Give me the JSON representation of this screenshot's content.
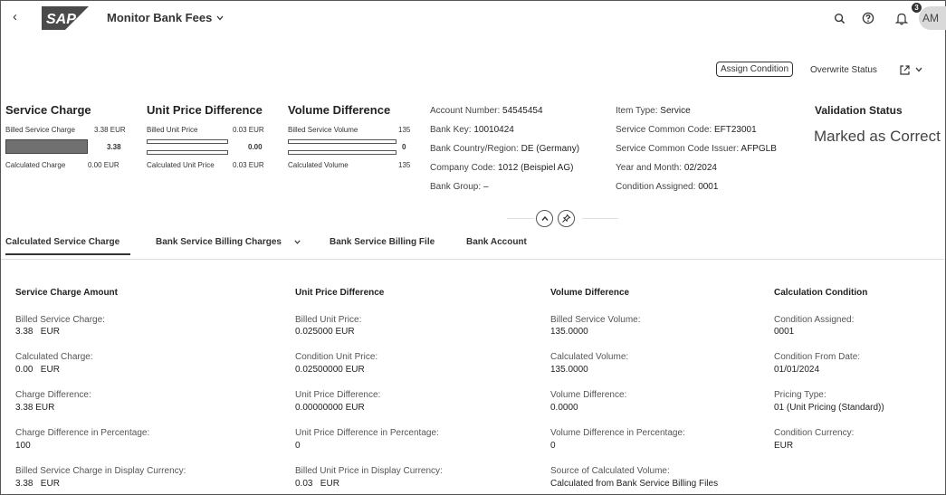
{
  "shell": {
    "app_title": "Monitor Bank Fees",
    "logo_text": "SAP",
    "notification_count": "3",
    "avatar_initials": "AM"
  },
  "toolbar": {
    "assign_condition": "Assign Condition",
    "overwrite_status": "Overwrite Status"
  },
  "kpis": {
    "service_charge": {
      "title": "Service Charge",
      "billed_label": "Billed Service Charge",
      "billed_value": "3.38 EUR",
      "bar_value": "3.38",
      "calc_label": "Calculated Charge",
      "calc_value": "0.00 EUR"
    },
    "unit_price": {
      "title": "Unit Price Difference",
      "billed_label": "Billed Unit Price",
      "billed_value": "0.03 EUR",
      "bar_value": "0.00",
      "calc_label": "Calculated Unit Price",
      "calc_value": "0.03 EUR"
    },
    "volume": {
      "title": "Volume Difference",
      "billed_label": "Billed Service Volume",
      "billed_value": "135",
      "bar_value": "0",
      "calc_label": "Calculated Volume",
      "calc_value": "135"
    }
  },
  "attributes": {
    "account_number_label": "Account Number:",
    "account_number": "54545454",
    "bank_key_label": "Bank Key:",
    "bank_key": "10010424",
    "bank_country_label": "Bank Country/Region:",
    "bank_country": "DE (Germany)",
    "company_code_label": "Company Code:",
    "company_code": "1012 (Beispiel AG)",
    "bank_group_label": "Bank Group:",
    "bank_group": "–",
    "item_type_label": "Item Type:",
    "item_type": "Service",
    "common_code_label": "Service Common Code:",
    "common_code": "EFT23001",
    "common_code_issuer_label": "Service Common Code Issuer:",
    "common_code_issuer": "AFPGLB",
    "year_month_label": "Year and Month:",
    "year_month": "02/2024",
    "condition_assigned_label": "Condition Assigned:",
    "condition_assigned": "0001"
  },
  "validation": {
    "title": "Validation Status",
    "status": "Marked as Correct"
  },
  "tabs": [
    "Calculated Service Charge",
    "Bank Service Billing Charges",
    "Bank Service Billing File",
    "Bank Account"
  ],
  "sections": {
    "service_charge": {
      "title": "Service Charge Amount",
      "fields": [
        {
          "label": "Billed Service Charge:",
          "value": "3.38   EUR"
        },
        {
          "label": "Calculated Charge:",
          "value": "0.00   EUR"
        },
        {
          "label": "Charge Difference:",
          "value": "3.38 EUR"
        },
        {
          "label": "Charge Difference in Percentage:",
          "value": "100"
        },
        {
          "label": "Billed Service Charge in Display Currency:",
          "value": "3.38   EUR"
        }
      ]
    },
    "unit_price": {
      "title": "Unit Price Difference",
      "fields": [
        {
          "label": "Billed Unit Price:",
          "value": "0.025000 EUR"
        },
        {
          "label": "Condition Unit Price:",
          "value": "0.02500000 EUR"
        },
        {
          "label": "Unit Price Difference:",
          "value": "0.00000000 EUR"
        },
        {
          "label": "Unit Price Difference in Percentage:",
          "value": "0"
        },
        {
          "label": "Billed Unit Price in Display Currency:",
          "value": "0.03   EUR"
        }
      ]
    },
    "volume": {
      "title": "Volume Difference",
      "fields": [
        {
          "label": "Billed Service Volume:",
          "value": "135.0000"
        },
        {
          "label": "Calculated Volume:",
          "value": "135.0000"
        },
        {
          "label": "Volume Difference:",
          "value": "0.0000"
        },
        {
          "label": "Volume Difference in Percentage:",
          "value": "0"
        },
        {
          "label": "Source of Calculated Volume:",
          "value": "Calculated from Bank Service Billing Files"
        }
      ]
    },
    "condition": {
      "title": "Calculation Condition",
      "fields": [
        {
          "label": "Condition Assigned:",
          "value": "0001"
        },
        {
          "label": "Condition From Date:",
          "value": "01/01/2024"
        },
        {
          "label": "Pricing Type:",
          "value": "01 (Unit Pricing (Standard))"
        },
        {
          "label": "Condition Currency:",
          "value": "EUR"
        }
      ]
    }
  },
  "icons": [
    "back-icon",
    "chevron-down-icon",
    "search-icon",
    "help-icon",
    "bell-icon",
    "share-icon",
    "collapse-up-icon",
    "pin-icon"
  ]
}
